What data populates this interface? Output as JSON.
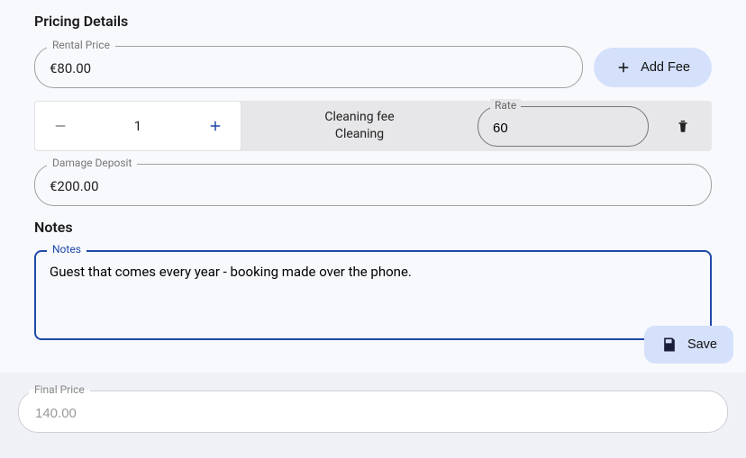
{
  "sections": {
    "pricing_title": "Pricing Details",
    "notes_title": "Notes"
  },
  "rental": {
    "label": "Rental Price",
    "value": "€80.00"
  },
  "add_fee_label": "Add Fee",
  "fee": {
    "quantity": "1",
    "name_line1": "Cleaning fee",
    "name_line2": "Cleaning",
    "rate_label": "Rate",
    "rate_value": "60"
  },
  "deposit": {
    "label": "Damage Deposit",
    "value": "€200.00"
  },
  "notes": {
    "label": "Notes",
    "value": "Guest that comes every year - booking made over the phone."
  },
  "save_label": "Save",
  "final": {
    "label": "Final Price",
    "value": "140.00"
  }
}
